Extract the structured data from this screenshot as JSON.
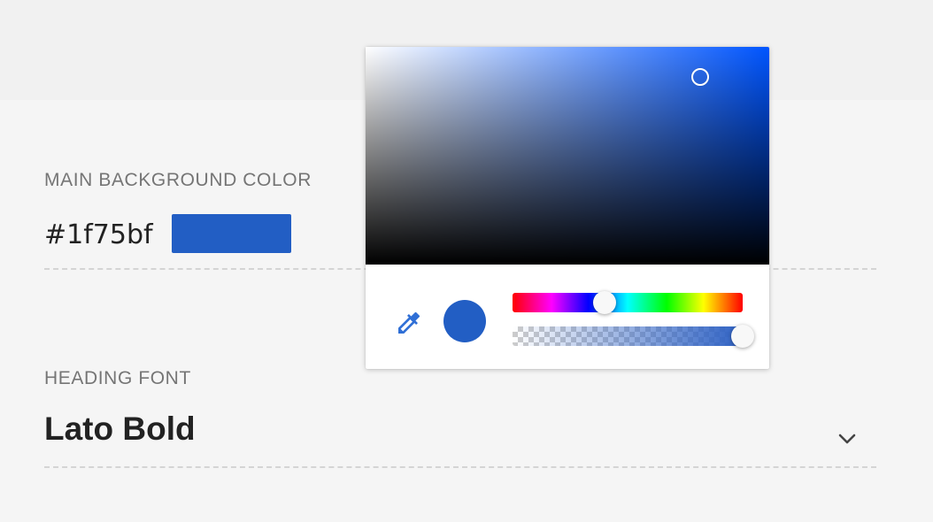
{
  "settings": {
    "background": {
      "label": "MAIN BACKGROUND COLOR",
      "hex_value": "#1f75bf",
      "swatch_color": "#225ec4"
    },
    "heading_font": {
      "label": "HEADING FONT",
      "value": "Lato Bold"
    }
  },
  "color_picker": {
    "hue_color": "#0055ff",
    "preview_color": "#225ec4",
    "alpha_color": "#2f62c4",
    "saturation": 0.83,
    "brightness": 0.86,
    "hue_fraction": 0.4,
    "alpha": 1.0,
    "icons": {
      "eyedropper": "eyedropper-icon",
      "chevron": "chevron-down-icon"
    }
  }
}
